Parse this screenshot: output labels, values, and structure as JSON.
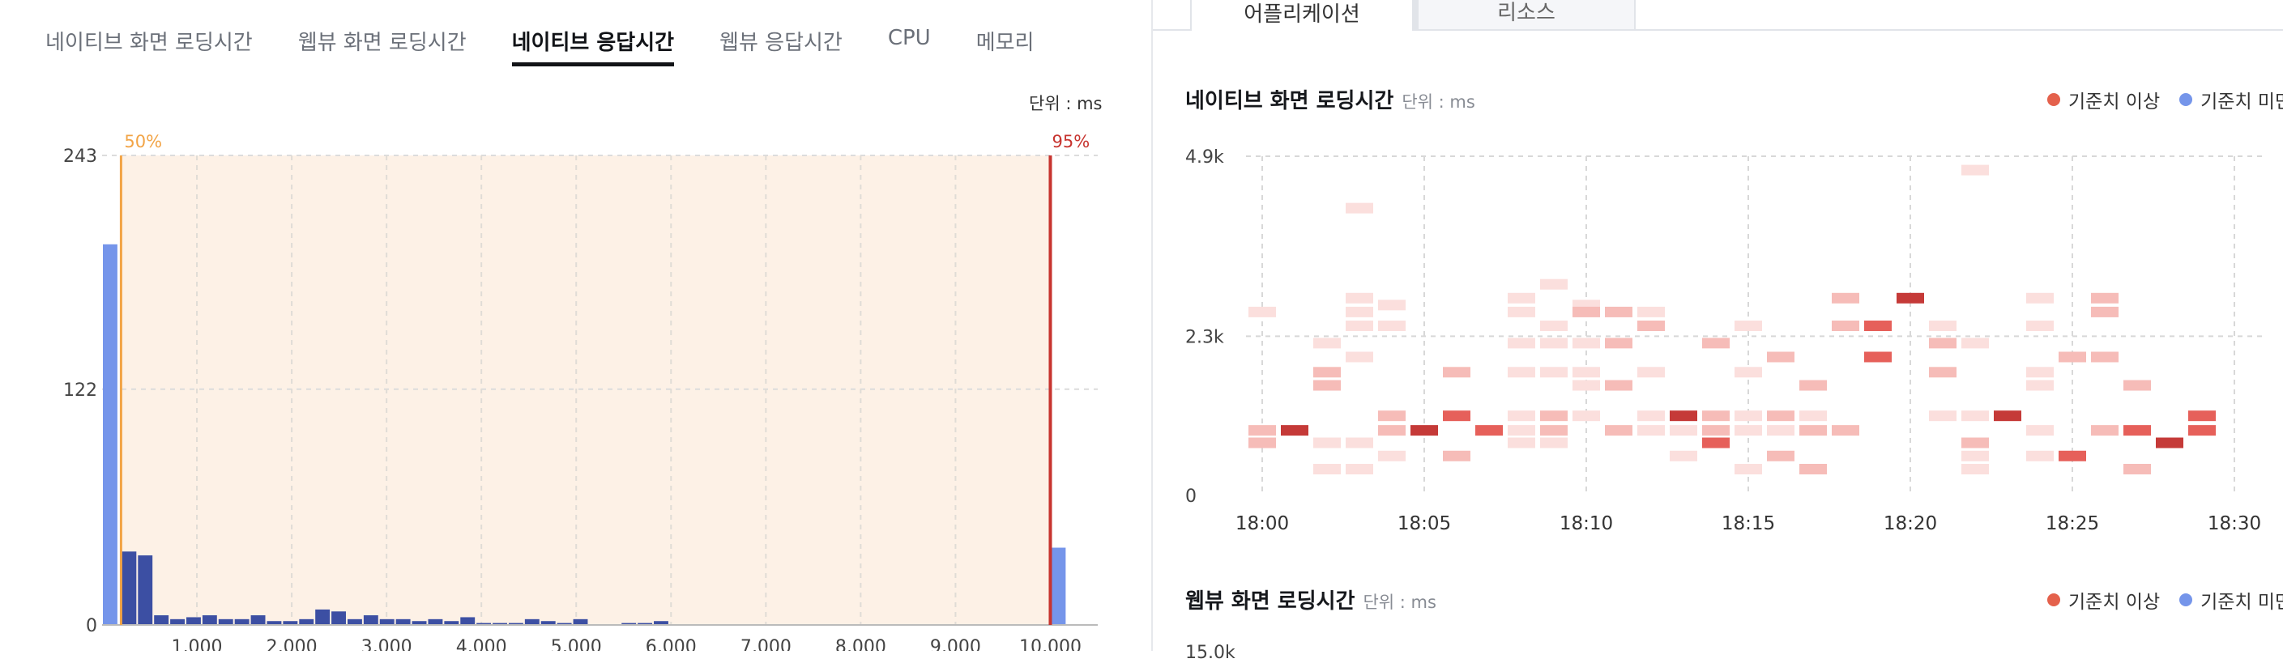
{
  "tabs": [
    {
      "label": "네이티브 화면 로딩시간",
      "active": false
    },
    {
      "label": "웹뷰 화면 로딩시간",
      "active": false
    },
    {
      "label": "네이티브 응답시간",
      "active": true
    },
    {
      "label": "웹뷰 응답시간",
      "active": false
    },
    {
      "label": "CPU",
      "active": false
    },
    {
      "label": "메모리",
      "active": false
    }
  ],
  "histogram": {
    "unit": "단위 : ms",
    "percentile_50_label": "50%",
    "percentile_95_label": "95%",
    "colors": {
      "bar": "#3c4fa3",
      "edge_bar": "#7595ea",
      "band": "#fdf1e6",
      "p50": "#f2a446",
      "p95": "#c7342f"
    }
  },
  "right_tabs": {
    "active": "어플리케이션",
    "inactive": "리소스"
  },
  "heatmap_1": {
    "title": "네이티브 화면 로딩시간",
    "unit": "단위 : ms",
    "legend": [
      {
        "label": "기준치 이상",
        "color": "#e4614c"
      },
      {
        "label": "기준치 미만",
        "color": "#7595ea"
      }
    ]
  },
  "heatmap_2": {
    "title": "웹뷰 화면 로딩시간",
    "unit": "단위 : ms",
    "legend": [
      {
        "label": "기준치 이상",
        "color": "#e4614c"
      },
      {
        "label": "기준치 미만",
        "color": "#7595ea"
      }
    ],
    "partial_tick": "15.0k"
  },
  "chart_data": [
    {
      "type": "bar",
      "x_ticks": [
        "1,000",
        "2,000",
        "3,000",
        "4,000",
        "5,000",
        "6,000",
        "7,000",
        "8,000",
        "9,000",
        "10,000"
      ],
      "y_ticks": [
        "0",
        "122",
        "243"
      ],
      "ylim": [
        0,
        243
      ],
      "xlim": [
        0,
        10500
      ],
      "bin_width": 170,
      "percentiles": {
        "p50": 200,
        "p95": 10000
      },
      "bins": [
        {
          "x": 0,
          "value": 197,
          "edge": true
        },
        {
          "x": 200,
          "value": 38
        },
        {
          "x": 370,
          "value": 36
        },
        {
          "x": 540,
          "value": 5
        },
        {
          "x": 710,
          "value": 3
        },
        {
          "x": 880,
          "value": 4
        },
        {
          "x": 1050,
          "value": 5
        },
        {
          "x": 1220,
          "value": 3
        },
        {
          "x": 1390,
          "value": 3
        },
        {
          "x": 1560,
          "value": 5
        },
        {
          "x": 1730,
          "value": 2
        },
        {
          "x": 1900,
          "value": 2
        },
        {
          "x": 2070,
          "value": 3
        },
        {
          "x": 2240,
          "value": 8
        },
        {
          "x": 2410,
          "value": 7
        },
        {
          "x": 2580,
          "value": 3
        },
        {
          "x": 2750,
          "value": 5
        },
        {
          "x": 2920,
          "value": 3
        },
        {
          "x": 3090,
          "value": 3
        },
        {
          "x": 3260,
          "value": 2
        },
        {
          "x": 3430,
          "value": 3
        },
        {
          "x": 3600,
          "value": 2
        },
        {
          "x": 3770,
          "value": 4
        },
        {
          "x": 3940,
          "value": 1
        },
        {
          "x": 4110,
          "value": 1
        },
        {
          "x": 4280,
          "value": 1
        },
        {
          "x": 4450,
          "value": 3
        },
        {
          "x": 4620,
          "value": 2
        },
        {
          "x": 4790,
          "value": 1
        },
        {
          "x": 4960,
          "value": 3
        },
        {
          "x": 5470,
          "value": 1
        },
        {
          "x": 5640,
          "value": 1
        },
        {
          "x": 5810,
          "value": 2
        },
        {
          "x": 10000,
          "value": 40,
          "edge": true
        }
      ]
    },
    {
      "type": "heatmap",
      "x_ticks": [
        "18:00",
        "18:05",
        "18:10",
        "18:15",
        "18:20",
        "18:25",
        "18:30"
      ],
      "y_ticks": [
        "0",
        "2.3k",
        "4.9k"
      ],
      "x_range_minutes": [
        0,
        30
      ],
      "ylim": [
        0,
        4900
      ],
      "cells": [
        {
          "t": 0,
          "v": 2650,
          "level": 1
        },
        {
          "t": 0,
          "v": 940,
          "level": 2
        },
        {
          "t": 0,
          "v": 760,
          "level": 2
        },
        {
          "t": 1,
          "v": 940,
          "level": 5
        },
        {
          "t": 2,
          "v": 2200,
          "level": 1
        },
        {
          "t": 2,
          "v": 1780,
          "level": 2
        },
        {
          "t": 2,
          "v": 1590,
          "level": 2
        },
        {
          "t": 2,
          "v": 760,
          "level": 1
        },
        {
          "t": 2,
          "v": 380,
          "level": 1
        },
        {
          "t": 3,
          "v": 4150,
          "level": 1
        },
        {
          "t": 3,
          "v": 2850,
          "level": 1
        },
        {
          "t": 3,
          "v": 2650,
          "level": 1
        },
        {
          "t": 3,
          "v": 2450,
          "level": 1
        },
        {
          "t": 3,
          "v": 2000,
          "level": 1
        },
        {
          "t": 3,
          "v": 760,
          "level": 1
        },
        {
          "t": 3,
          "v": 380,
          "level": 1
        },
        {
          "t": 4,
          "v": 2750,
          "level": 1
        },
        {
          "t": 4,
          "v": 2450,
          "level": 1
        },
        {
          "t": 4,
          "v": 1150,
          "level": 2
        },
        {
          "t": 4,
          "v": 940,
          "level": 2
        },
        {
          "t": 4,
          "v": 570,
          "level": 1
        },
        {
          "t": 5,
          "v": 940,
          "level": 5
        },
        {
          "t": 6,
          "v": 1780,
          "level": 2
        },
        {
          "t": 6,
          "v": 1150,
          "level": 4
        },
        {
          "t": 6,
          "v": 570,
          "level": 2
        },
        {
          "t": 7,
          "v": 940,
          "level": 4
        },
        {
          "t": 8,
          "v": 2850,
          "level": 1
        },
        {
          "t": 8,
          "v": 2650,
          "level": 1
        },
        {
          "t": 8,
          "v": 2200,
          "level": 1
        },
        {
          "t": 8,
          "v": 1780,
          "level": 1
        },
        {
          "t": 8,
          "v": 1150,
          "level": 1
        },
        {
          "t": 8,
          "v": 940,
          "level": 1
        },
        {
          "t": 8,
          "v": 760,
          "level": 1
        },
        {
          "t": 9,
          "v": 3050,
          "level": 1
        },
        {
          "t": 9,
          "v": 2450,
          "level": 1
        },
        {
          "t": 9,
          "v": 2200,
          "level": 1
        },
        {
          "t": 9,
          "v": 1780,
          "level": 1
        },
        {
          "t": 9,
          "v": 1150,
          "level": 2
        },
        {
          "t": 9,
          "v": 940,
          "level": 2
        },
        {
          "t": 9,
          "v": 760,
          "level": 1
        },
        {
          "t": 10,
          "v": 2750,
          "level": 1
        },
        {
          "t": 10,
          "v": 2650,
          "level": 2
        },
        {
          "t": 10,
          "v": 2200,
          "level": 1
        },
        {
          "t": 10,
          "v": 1780,
          "level": 1
        },
        {
          "t": 10,
          "v": 1590,
          "level": 1
        },
        {
          "t": 10,
          "v": 1150,
          "level": 1
        },
        {
          "t": 11,
          "v": 2650,
          "level": 2
        },
        {
          "t": 11,
          "v": 2200,
          "level": 2
        },
        {
          "t": 11,
          "v": 1590,
          "level": 2
        },
        {
          "t": 11,
          "v": 940,
          "level": 2
        },
        {
          "t": 12,
          "v": 2650,
          "level": 1
        },
        {
          "t": 12,
          "v": 2450,
          "level": 2
        },
        {
          "t": 12,
          "v": 1780,
          "level": 1
        },
        {
          "t": 12,
          "v": 1150,
          "level": 1
        },
        {
          "t": 12,
          "v": 940,
          "level": 1
        },
        {
          "t": 13,
          "v": 1150,
          "level": 5
        },
        {
          "t": 13,
          "v": 940,
          "level": 1
        },
        {
          "t": 13,
          "v": 570,
          "level": 1
        },
        {
          "t": 14,
          "v": 2200,
          "level": 2
        },
        {
          "t": 14,
          "v": 1150,
          "level": 2
        },
        {
          "t": 14,
          "v": 940,
          "level": 2
        },
        {
          "t": 14,
          "v": 760,
          "level": 4
        },
        {
          "t": 15,
          "v": 2450,
          "level": 1
        },
        {
          "t": 15,
          "v": 1780,
          "level": 1
        },
        {
          "t": 15,
          "v": 1150,
          "level": 1
        },
        {
          "t": 15,
          "v": 940,
          "level": 1
        },
        {
          "t": 15,
          "v": 380,
          "level": 1
        },
        {
          "t": 16,
          "v": 2000,
          "level": 2
        },
        {
          "t": 16,
          "v": 1150,
          "level": 2
        },
        {
          "t": 16,
          "v": 940,
          "level": 1
        },
        {
          "t": 16,
          "v": 570,
          "level": 2
        },
        {
          "t": 17,
          "v": 1590,
          "level": 2
        },
        {
          "t": 17,
          "v": 1150,
          "level": 1
        },
        {
          "t": 17,
          "v": 940,
          "level": 2
        },
        {
          "t": 17,
          "v": 380,
          "level": 2
        },
        {
          "t": 18,
          "v": 2850,
          "level": 2
        },
        {
          "t": 18,
          "v": 2450,
          "level": 2
        },
        {
          "t": 18,
          "v": 940,
          "level": 2
        },
        {
          "t": 19,
          "v": 2450,
          "level": 4
        },
        {
          "t": 19,
          "v": 2000,
          "level": 4
        },
        {
          "t": 20,
          "v": 2850,
          "level": 5
        },
        {
          "t": 21,
          "v": 2450,
          "level": 1
        },
        {
          "t": 21,
          "v": 2200,
          "level": 2
        },
        {
          "t": 21,
          "v": 1780,
          "level": 2
        },
        {
          "t": 21,
          "v": 1150,
          "level": 1
        },
        {
          "t": 22,
          "v": 4700,
          "level": 1
        },
        {
          "t": 22,
          "v": 2200,
          "level": 1
        },
        {
          "t": 22,
          "v": 1150,
          "level": 1
        },
        {
          "t": 22,
          "v": 760,
          "level": 2
        },
        {
          "t": 22,
          "v": 570,
          "level": 1
        },
        {
          "t": 22,
          "v": 380,
          "level": 1
        },
        {
          "t": 23,
          "v": 1150,
          "level": 5
        },
        {
          "t": 24,
          "v": 2850,
          "level": 1
        },
        {
          "t": 24,
          "v": 2450,
          "level": 1
        },
        {
          "t": 24,
          "v": 1780,
          "level": 1
        },
        {
          "t": 24,
          "v": 1590,
          "level": 1
        },
        {
          "t": 24,
          "v": 940,
          "level": 1
        },
        {
          "t": 24,
          "v": 570,
          "level": 1
        },
        {
          "t": 25,
          "v": 2000,
          "level": 2
        },
        {
          "t": 25,
          "v": 570,
          "level": 4
        },
        {
          "t": 26,
          "v": 2850,
          "level": 2
        },
        {
          "t": 26,
          "v": 2650,
          "level": 2
        },
        {
          "t": 26,
          "v": 2000,
          "level": 2
        },
        {
          "t": 26,
          "v": 940,
          "level": 2
        },
        {
          "t": 27,
          "v": 1590,
          "level": 2
        },
        {
          "t": 27,
          "v": 940,
          "level": 4
        },
        {
          "t": 27,
          "v": 380,
          "level": 2
        },
        {
          "t": 28,
          "v": 760,
          "level": 5
        },
        {
          "t": 29,
          "v": 1150,
          "level": 4
        },
        {
          "t": 29,
          "v": 940,
          "level": 4
        }
      ]
    }
  ]
}
